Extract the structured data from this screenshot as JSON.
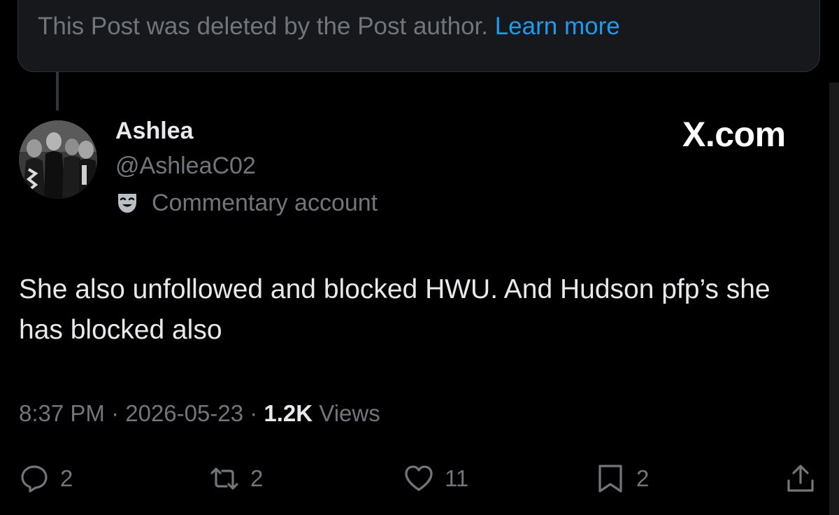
{
  "deleted_notice": {
    "text": "This Post was deleted by the Post author.",
    "link": "Learn more"
  },
  "author": {
    "display_name": "Ashlea",
    "handle": "@AshleaC02",
    "label": "Commentary account",
    "label_icon": "theater-mask-icon"
  },
  "brand": "X.com",
  "post": {
    "text": "She also unfollowed and blocked HWU. And Hudson pfp’s she has blocked also"
  },
  "meta": {
    "time": "8:37 PM",
    "separator": "·",
    "date": "2026-05-23",
    "views_count": "1.2K",
    "views_label": "Views"
  },
  "actions": {
    "replies": "2",
    "reposts": "2",
    "likes": "11",
    "bookmarks": "2"
  },
  "colors": {
    "background": "#000000",
    "card": "#16181c",
    "muted": "#71767b",
    "text": "#e7e9ea",
    "link": "#1d9bf0"
  }
}
